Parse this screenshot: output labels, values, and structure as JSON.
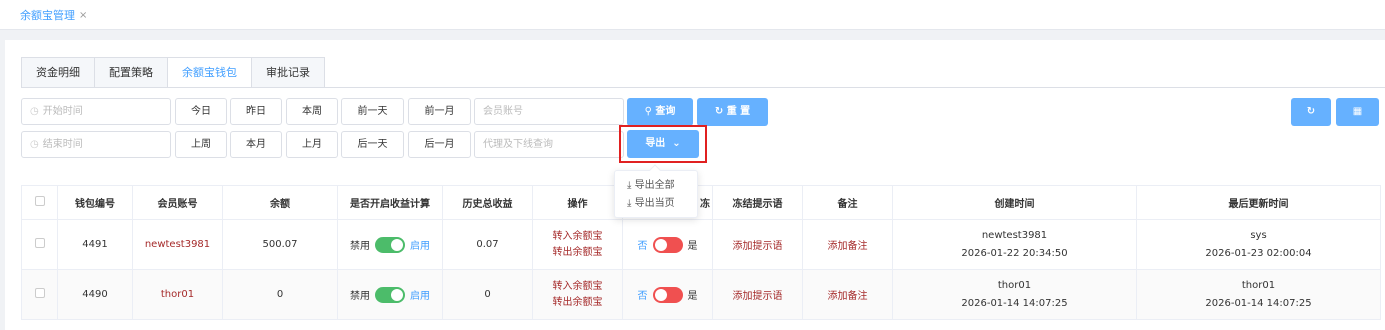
{
  "page_tab": {
    "label": "余额宝管理",
    "close": "×"
  },
  "tabs": [
    "资金明细",
    "配置策略",
    "余额宝钱包",
    "审批记录"
  ],
  "filters": {
    "start_time": "开始时间",
    "end_time": "结束时间",
    "row1_buttons": [
      "今日",
      "昨日",
      "本周",
      "前一天",
      "前一月"
    ],
    "row2_buttons": [
      "上周",
      "本月",
      "上月",
      "后一天",
      "后一月"
    ],
    "member_account": "会员账号",
    "agent_query": "代理及下线查询",
    "query": "查询",
    "reset": "重 置",
    "export": "导出"
  },
  "export_menu": [
    "导出全部",
    "导出当页"
  ],
  "table": {
    "headers": [
      "钱包编号",
      "会员账号",
      "余额",
      "是否开启收益计算",
      "历史总收益",
      "操作",
      "",
      "冻结提示语",
      "备注",
      "创建时间",
      "最后更新时间"
    ],
    "header_frozen_partial": "是否冻结",
    "rows": [
      {
        "id": "4491",
        "account": "newtest3981",
        "balance": "500.07",
        "income_off": "禁用",
        "income_on": "启用",
        "income_enabled": true,
        "total": "0.07",
        "op_in": "转入余额宝",
        "op_out": "转出余额宝",
        "freeze_no": "否",
        "freeze_yes": "是",
        "frozen": false,
        "hint": "添加提示语",
        "remark": "添加备注",
        "created_by": "newtest3981",
        "created_at": "2026-01-22 20:34:50",
        "updated_by": "sys",
        "updated_at": "2026-01-23 02:00:04"
      },
      {
        "id": "4490",
        "account": "thor01",
        "balance": "0",
        "income_off": "禁用",
        "income_on": "启用",
        "income_enabled": true,
        "total": "0",
        "op_in": "转入余额宝",
        "op_out": "转出余额宝",
        "freeze_no": "否",
        "freeze_yes": "是",
        "frozen": false,
        "hint": "添加提示语",
        "remark": "添加备注",
        "created_by": "thor01",
        "created_at": "2026-01-14 14:07:25",
        "updated_by": "thor01",
        "updated_at": "2026-01-14 14:07:25"
      }
    ]
  },
  "colors": {
    "primary": "#409eff",
    "button_primary": "#66b1ff",
    "highlight": "#e02020",
    "link_red": "#a52a2a",
    "switch_on": "#4cbc6a",
    "switch_off": "#f05050"
  }
}
